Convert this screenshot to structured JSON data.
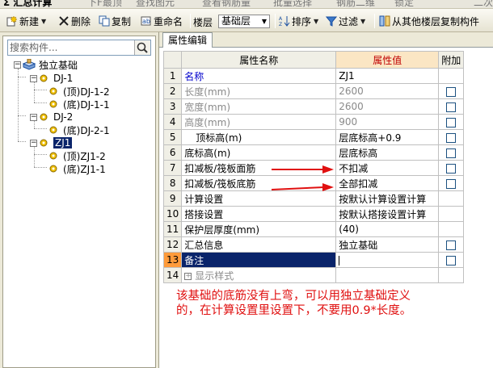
{
  "topbar": {
    "items": [
      "Σ 汇总计算",
      "下F最顶",
      "查找图元",
      "查看钢筋量",
      "批量选择",
      "钢筋二维",
      "锁定",
      "二次"
    ]
  },
  "toolbar": {
    "new_label": "新建",
    "delete_label": "删除",
    "copy_label": "复制",
    "rename_label": "重命名",
    "floor_label": "楼层",
    "floor_value": "基础层",
    "sort_label": "排序",
    "filter_label": "过滤",
    "copy_from_floor_label": "从其他楼层复制构件"
  },
  "search": {
    "placeholder": "搜索构件..."
  },
  "tree": {
    "root": "独立基础",
    "groups": [
      {
        "name": "DJ-1",
        "children": [
          "(顶)DJ-1-2",
          "(底)DJ-1-1"
        ]
      },
      {
        "name": "DJ-2",
        "children": [
          "(底)DJ-2-1"
        ]
      },
      {
        "name": "ZJ1",
        "children": [
          "(顶)ZJ1-2",
          "(底)ZJ1-1"
        ]
      }
    ]
  },
  "tab": {
    "label": "属性编辑"
  },
  "grid": {
    "headers": {
      "name": "属性名称",
      "value": "属性值",
      "extra": "附加"
    },
    "rows": [
      {
        "num": "1",
        "name": "名称",
        "value": "ZJ1"
      },
      {
        "num": "2",
        "name": "长度(mm)",
        "value": "2600"
      },
      {
        "num": "3",
        "name": "宽度(mm)",
        "value": "2600"
      },
      {
        "num": "4",
        "name": "高度(mm)",
        "value": "900"
      },
      {
        "num": "5",
        "name": "顶标高(m)",
        "value": "层底标高+0.9"
      },
      {
        "num": "6",
        "name": "底标高(m)",
        "value": "层底标高"
      },
      {
        "num": "7",
        "name": "扣减板/筏板面筋",
        "value": "不扣减"
      },
      {
        "num": "8",
        "name": "扣减板/筏板底筋",
        "value": "全部扣减"
      },
      {
        "num": "9",
        "name": "计算设置",
        "value": "按默认计算设置计算"
      },
      {
        "num": "10",
        "name": "搭接设置",
        "value": "按默认搭接设置计算"
      },
      {
        "num": "11",
        "name": "保护层厚度(mm)",
        "value": "(40)"
      },
      {
        "num": "12",
        "name": "汇总信息",
        "value": "独立基础"
      },
      {
        "num": "13",
        "name": "备注",
        "value": ""
      },
      {
        "num": "14",
        "name": "显示样式",
        "value": ""
      }
    ]
  },
  "annotation": {
    "line1": "该基础的底筋没有上弯，可以用独立基础定义",
    "line2": "的，在计算设置里设置下，不要用0.9*长度。"
  },
  "colors": {
    "annotation": "#e01010",
    "selection": "#0a246a",
    "active_row": "#ff9b3b"
  }
}
